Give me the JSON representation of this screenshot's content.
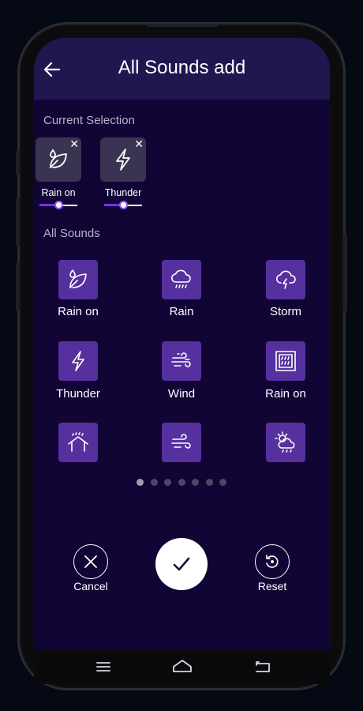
{
  "header": {
    "title": "All Sounds add",
    "back_icon": "arrow-left-icon"
  },
  "current_selection": {
    "heading": "Current Selection",
    "remove_glyph": "✕",
    "items": [
      {
        "label": "Rain on",
        "icon": "leaf-drop-icon",
        "volume": 0.5
      },
      {
        "label": "Thunder",
        "icon": "lightning-icon",
        "volume": 0.5
      }
    ]
  },
  "all_sounds": {
    "heading": "All Sounds",
    "items": [
      {
        "label": "Rain on",
        "icon": "leaf-drop-icon"
      },
      {
        "label": "Rain",
        "icon": "cloud-rain-icon"
      },
      {
        "label": "Storm",
        "icon": "cloud-lightning-icon"
      },
      {
        "label": "Thunder",
        "icon": "lightning-icon"
      },
      {
        "label": "Wind",
        "icon": "wind-icon"
      },
      {
        "label": "Rain on",
        "icon": "window-rain-icon"
      },
      {
        "label": "",
        "icon": "house-rain-icon"
      },
      {
        "label": "",
        "icon": "wind-icon"
      },
      {
        "label": "",
        "icon": "sun-cloud-rain-icon"
      }
    ]
  },
  "pagination": {
    "count": 7,
    "active_index": 0
  },
  "actions": {
    "cancel_label": "Cancel",
    "reset_label": "Reset",
    "confirm_icon": "check-icon"
  },
  "colors": {
    "background": "#110535",
    "header": "#221650",
    "tile": "#56309e",
    "accent": "#7b2cf0"
  }
}
